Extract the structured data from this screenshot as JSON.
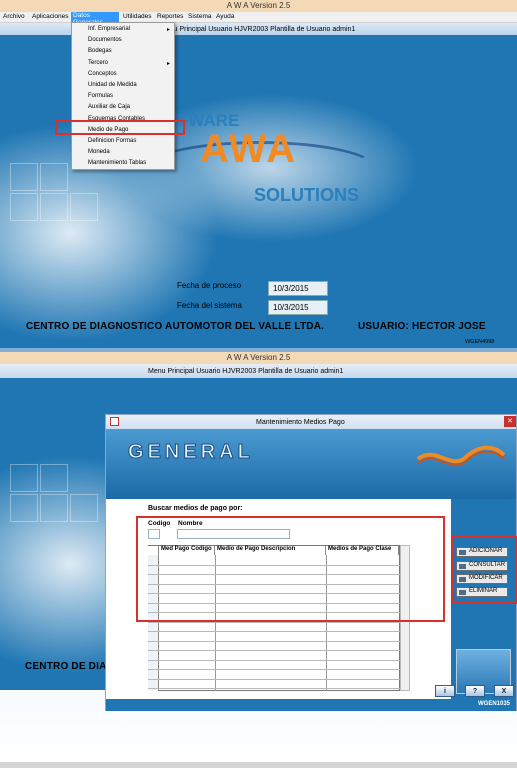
{
  "top_window": {
    "title": "A W A Version 2.5",
    "menu": [
      "Archivo",
      "Aplicaciones",
      "Datos Generales",
      "Utilidades",
      "Reportes",
      "Sistema",
      "Ayuda"
    ],
    "inner_title": "Menu Principal  Usuario HJVR2003 Plantilla de Usuario admin1",
    "dropdown": [
      {
        "label": "Inf. Empresarial",
        "submenu": true
      },
      {
        "label": "Documentos",
        "submenu": false
      },
      {
        "label": "Bodegas",
        "submenu": false
      },
      {
        "label": "Tercero",
        "submenu": true
      },
      {
        "label": "Conceptos",
        "submenu": false
      },
      {
        "label": "Unidad de Medida",
        "submenu": false
      },
      {
        "label": "Formulas",
        "submenu": false
      },
      {
        "label": "Auxiliar de Caja",
        "submenu": false
      },
      {
        "label": "Esquemas Contables",
        "submenu": false
      },
      {
        "label": "Medio de Pago",
        "submenu": false
      },
      {
        "label": "Definicion Formas",
        "submenu": false
      },
      {
        "label": "Moneda",
        "submenu": false
      },
      {
        "label": "Mantenimiento Tablas",
        "submenu": false
      }
    ],
    "logo_line1": "FWARE",
    "logo_awa": "AWA",
    "logo_line2": "SOLUTIONS",
    "fecha_proceso_label": "Fecha de proceso",
    "fecha_proceso_value": "10/3/2015",
    "fecha_sistema_label": "Fecha del sistema",
    "fecha_sistema_value": "10/3/2015",
    "company": "CENTRO DE DIAGNOSTICO AUTOMOTOR DEL VALLE LTDA.",
    "user_label": "USUARIO:  HECTOR JOSE",
    "code": "WGEN4998"
  },
  "bottom_window": {
    "title": "A W A Version 2.5",
    "inner_title": "Menu Principal  Usuario HJVR2003 Plantilla de Usuario admin1",
    "company_partial": "CENTRO DE DIA",
    "dialog": {
      "title": "Mantenimiento Medios Pago",
      "banner_text": "GENERAL",
      "search_title": "Buscar medios de pago por:",
      "codigo_label": "Codigo",
      "nombre_label": "Nombre",
      "columns": [
        "Med Pago Codigo",
        "Medio de  Pago Descripcion",
        "Medios de  Pago Clase"
      ],
      "row_count": 14,
      "buttons": [
        "ADICIONAR",
        "CONSULTAR",
        "MODIFICAR",
        "ELIMINAR"
      ],
      "nav_buttons": [
        "i",
        "?",
        "X"
      ],
      "code": "WGEN1035"
    }
  },
  "colors": {
    "desktop_blue": "#1f76b3",
    "titlebar": "#f3d9b5",
    "highlight_red": "#d9302f",
    "menu_selected": "#3399ff"
  }
}
